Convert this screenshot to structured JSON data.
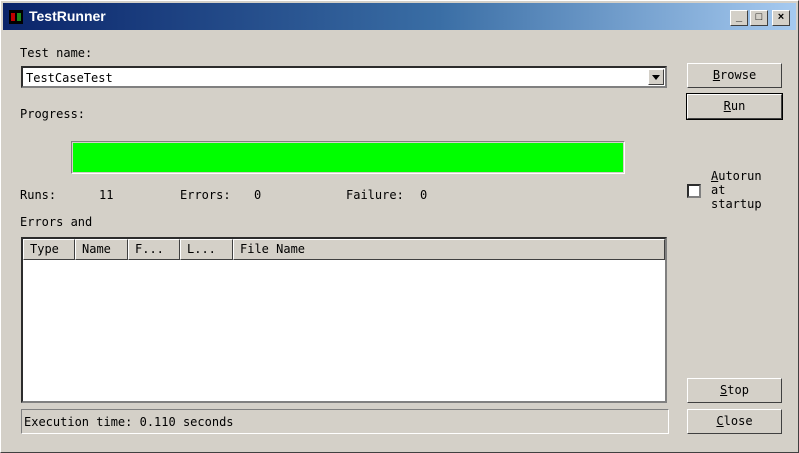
{
  "window": {
    "title": "TestRunner",
    "min_glyph": "_",
    "max_glyph": "□",
    "close_glyph": "×"
  },
  "test_name": {
    "label": "Test name:",
    "value": "TestCaseTest"
  },
  "buttons": {
    "browse": {
      "accel": "B",
      "rest": "rowse"
    },
    "run": {
      "accel": "R",
      "rest": "un"
    },
    "stop": {
      "accel": "S",
      "rest": "top"
    },
    "close": {
      "accel": "C",
      "rest": "lose"
    }
  },
  "progress": {
    "label": "Progress:",
    "fraction": 1.0,
    "color": "#00ff00"
  },
  "stats": {
    "runs_label": "Runs:",
    "runs_value": "11",
    "errors_label": "Errors:",
    "errors_value": "0",
    "failure_label": "Failure:",
    "failure_value": "0"
  },
  "autorun": {
    "accel": "A",
    "rest": "utorun at startup",
    "checked": false
  },
  "errors_section": {
    "label": "Errors and"
  },
  "table": {
    "columns": [
      "Type",
      "Name",
      "F...",
      "L...",
      "File Name"
    ],
    "rows": []
  },
  "status": {
    "text": "Execution time: 0.110 seconds"
  },
  "colors": {
    "face": "#d4d0c8",
    "title_start": "#0a246a",
    "title_end": "#a6caf0"
  }
}
